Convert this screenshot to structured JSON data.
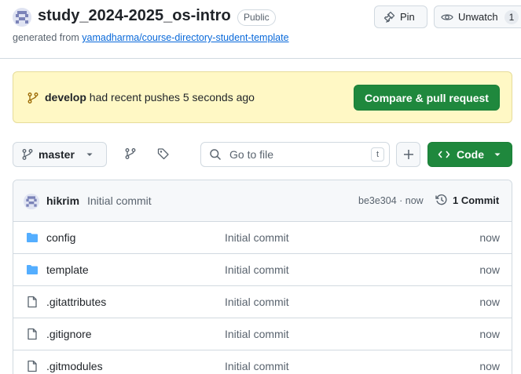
{
  "repo": {
    "name": "study_2024-2025_os-intro",
    "visibility": "Public",
    "generated_prefix": "generated from ",
    "template_link": "yamadharma/course-directory-student-template"
  },
  "actions": {
    "pin_label": "Pin",
    "watch_label": "Unwatch",
    "watch_count": "1"
  },
  "banner": {
    "branch": "develop",
    "message": " had recent pushes 5 seconds ago",
    "button_label": "Compare & pull request"
  },
  "toolbar": {
    "branch_label": "master",
    "search_placeholder": "Go to file",
    "search_shortcut": "t",
    "code_label": "Code"
  },
  "latest_commit": {
    "author": "hikrim",
    "message": "Initial commit",
    "hash_time": "be3e304 · now",
    "commit_count": "1 Commit"
  },
  "files": [
    {
      "name": "config",
      "type": "folder",
      "message": "Initial commit",
      "time": "now"
    },
    {
      "name": "template",
      "type": "folder",
      "message": "Initial commit",
      "time": "now"
    },
    {
      "name": ".gitattributes",
      "type": "file",
      "message": "Initial commit",
      "time": "now"
    },
    {
      "name": ".gitignore",
      "type": "file",
      "message": "Initial commit",
      "time": "now"
    },
    {
      "name": ".gitmodules",
      "type": "file",
      "message": "Initial commit",
      "time": "now"
    }
  ],
  "colors": {
    "accent_green": "#1f883d",
    "folder_blue": "#54aeff",
    "link_blue": "#0969da",
    "banner_bg": "#fff8c5"
  }
}
